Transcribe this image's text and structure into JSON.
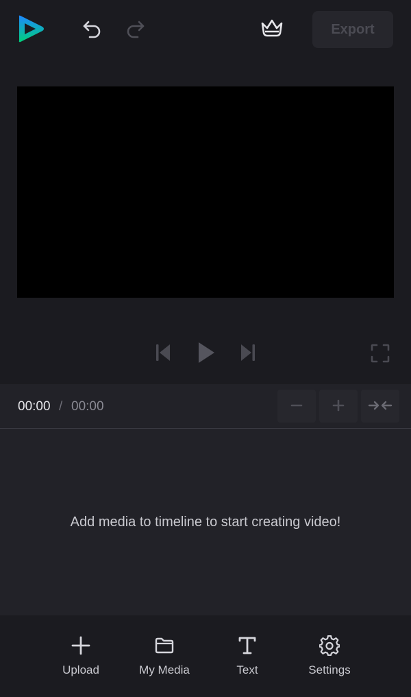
{
  "colors": {
    "background": "#1b1b20",
    "panel": "#222228",
    "preview": "#000000",
    "logo_gradient_start": "#1e88ff",
    "logo_gradient_end": "#00d07a",
    "disabled_text": "#4b4b53"
  },
  "topbar": {
    "logo_icon": "play-logo-icon",
    "undo_icon": "undo-icon",
    "redo_icon": "redo-icon",
    "premium_icon": "crown-icon",
    "export_label": "Export"
  },
  "player": {
    "prev_icon": "skip-back-icon",
    "play_icon": "play-icon",
    "next_icon": "skip-forward-icon",
    "fullscreen_icon": "fullscreen-icon"
  },
  "timeline": {
    "current_time": "00:00",
    "separator": "/",
    "total_time": "00:00",
    "zoom_out_icon": "minus-icon",
    "zoom_in_icon": "plus-icon",
    "fit_icon": "collapse-icon",
    "empty_message": "Add media to timeline to start creating video!"
  },
  "bottom_nav": {
    "items": [
      {
        "label": "Upload",
        "icon": "plus-icon"
      },
      {
        "label": "My Media",
        "icon": "folder-icon"
      },
      {
        "label": "Text",
        "icon": "text-icon"
      },
      {
        "label": "Settings",
        "icon": "gear-icon"
      }
    ]
  }
}
